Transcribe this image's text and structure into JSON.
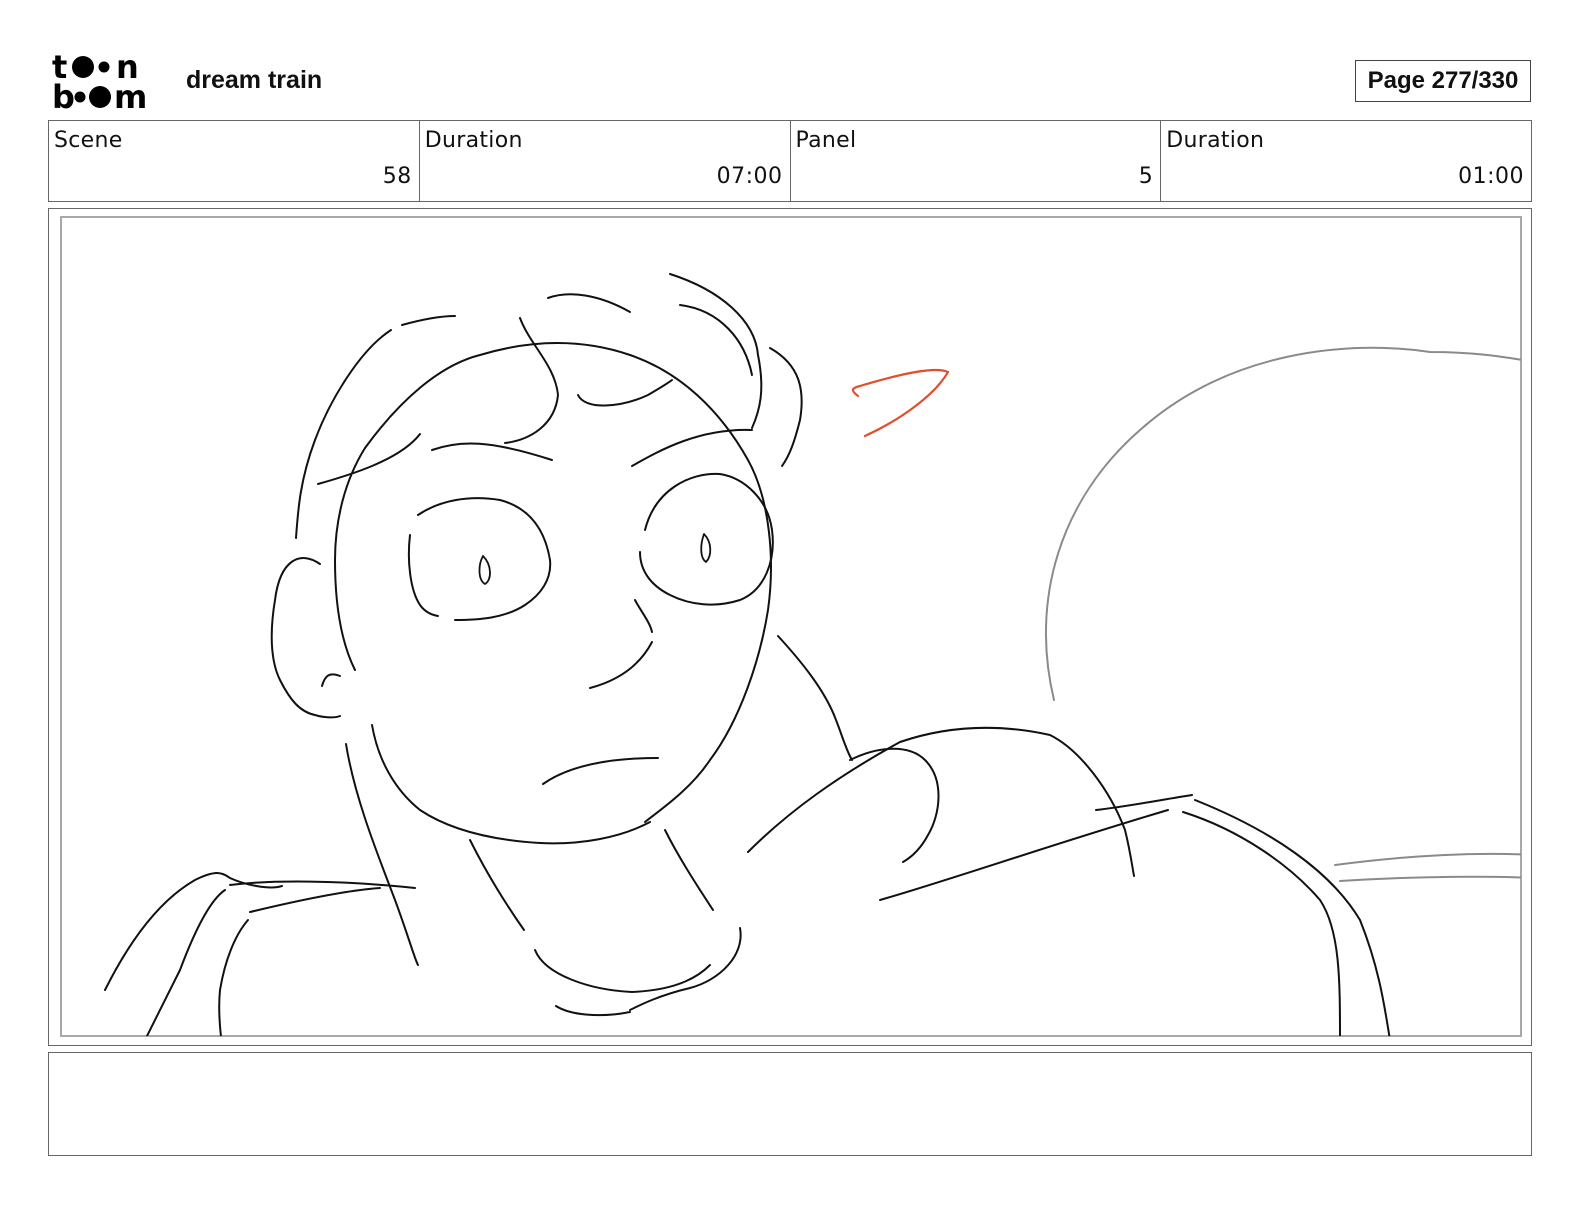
{
  "header": {
    "logo_name": "toonboom-logo",
    "project_title": "dream train",
    "page_label": "Page 277/330"
  },
  "info": [
    {
      "label": "Scene",
      "value": "58"
    },
    {
      "label": "Duration",
      "value": "07:00"
    },
    {
      "label": "Panel",
      "value": "5"
    },
    {
      "label": "Duration",
      "value": "01:00"
    }
  ],
  "panel": {
    "image_name": "storyboard-sketch",
    "line_color": "#111111",
    "background_line_color": "#8a8a8a",
    "action_mark_color": "#e0502c"
  },
  "notes": {
    "text": ""
  }
}
